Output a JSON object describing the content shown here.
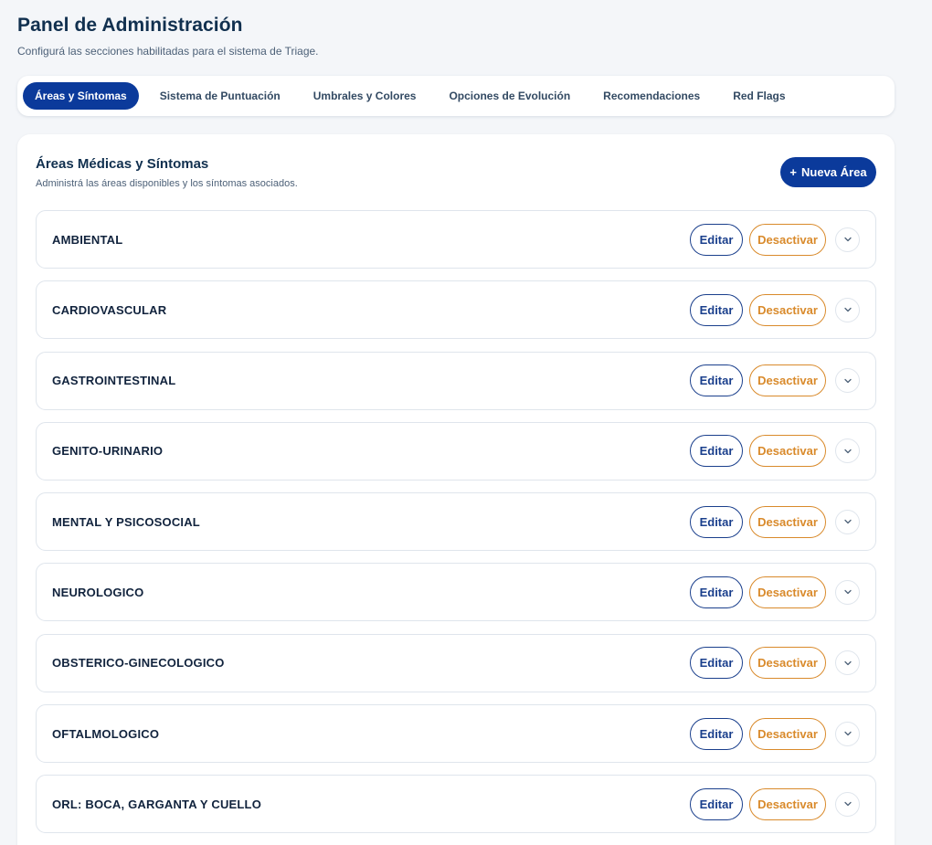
{
  "header": {
    "title": "Panel de Administración",
    "subtitle": "Configurá las secciones habilitadas para el sistema de Triage."
  },
  "tabs": [
    {
      "label": "Áreas y Síntomas",
      "active": true
    },
    {
      "label": "Sistema de Puntuación",
      "active": false
    },
    {
      "label": "Umbrales y Colores",
      "active": false
    },
    {
      "label": "Opciones de Evolución",
      "active": false
    },
    {
      "label": "Recomendaciones",
      "active": false
    },
    {
      "label": "Red Flags",
      "active": false
    }
  ],
  "card": {
    "title": "Áreas Médicas y Síntomas",
    "subtitle": "Administrá las áreas disponibles y los síntomas asociados.",
    "new_area_label": "Nueva Área",
    "new_area_icon": "plus-icon"
  },
  "row_actions": {
    "edit_label": "Editar",
    "deactivate_label": "Desactivar",
    "expand_icon": "chevron-down-icon"
  },
  "areas": [
    {
      "name": "AMBIENTAL"
    },
    {
      "name": "CARDIOVASCULAR"
    },
    {
      "name": "GASTROINTESTINAL"
    },
    {
      "name": "GENITO-URINARIO"
    },
    {
      "name": "MENTAL Y PSICOSOCIAL"
    },
    {
      "name": "NEUROLOGICO"
    },
    {
      "name": "OBSTERICO-GINECOLOGICO"
    },
    {
      "name": "OFTALMOLOGICO"
    },
    {
      "name": "ORL: BOCA, GARGANTA Y CUELLO"
    }
  ],
  "colors": {
    "primary": "#0b3a9b",
    "edit_border": "#1a3f8c",
    "deactivate": "#d98a2b",
    "background": "#f4f6f9"
  }
}
